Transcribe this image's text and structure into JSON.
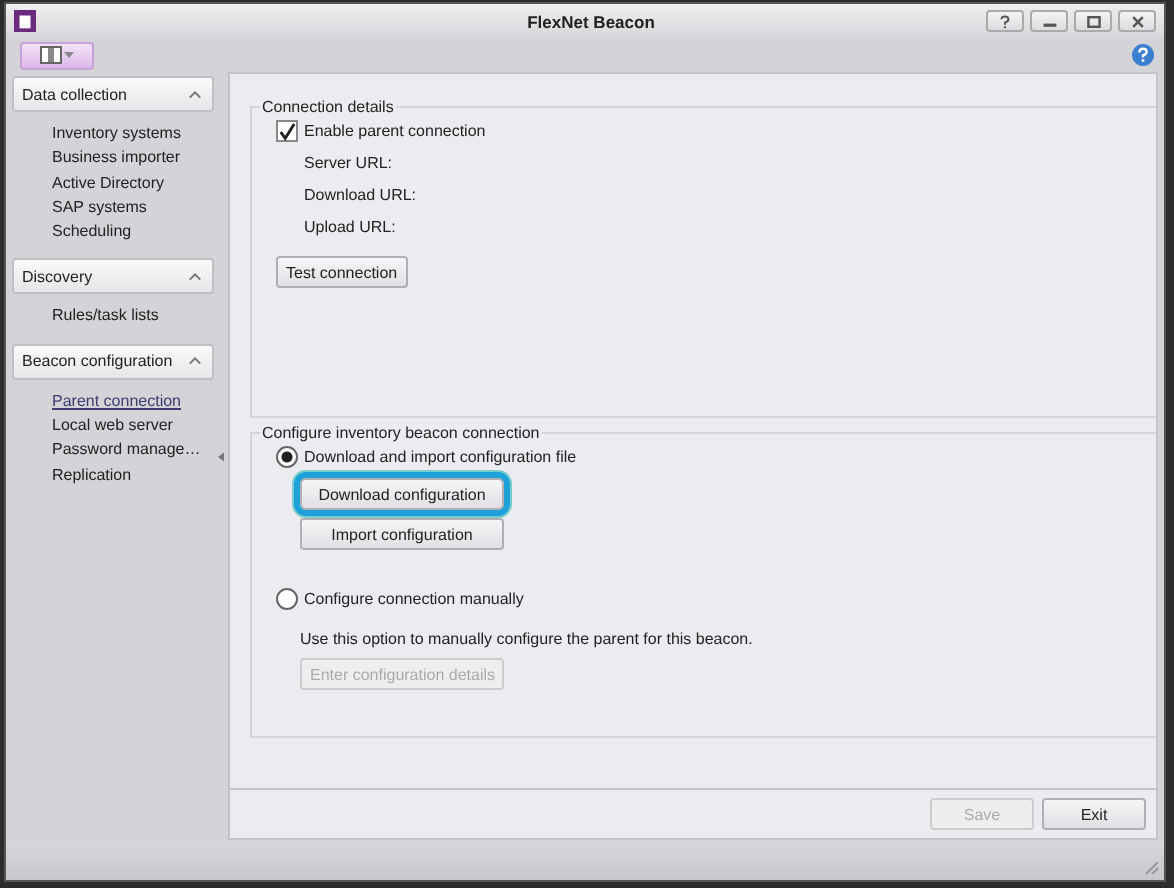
{
  "window": {
    "title": "FlexNet Beacon"
  },
  "sidebar": {
    "sections": [
      {
        "title": "Data collection",
        "expanded": true,
        "items": [
          {
            "label": "Inventory systems",
            "selected": false
          },
          {
            "label": "Business importer",
            "selected": false
          },
          {
            "label": "Active Directory",
            "selected": false
          },
          {
            "label": "SAP systems",
            "selected": false
          },
          {
            "label": "Scheduling",
            "selected": false
          }
        ]
      },
      {
        "title": "Discovery",
        "expanded": true,
        "items": [
          {
            "label": "Rules/task lists",
            "selected": false
          }
        ]
      },
      {
        "title": "Beacon configuration",
        "expanded": true,
        "items": [
          {
            "label": "Parent connection",
            "selected": true
          },
          {
            "label": "Local web server",
            "selected": false
          },
          {
            "label": "Password manage…",
            "selected": false
          },
          {
            "label": "Replication",
            "selected": false
          }
        ]
      }
    ]
  },
  "connection_details": {
    "title": "Connection details",
    "enable_parent": {
      "label": "Enable parent connection",
      "checked": true
    },
    "fields": [
      "Server URL:",
      "Download URL:",
      "Upload URL:"
    ],
    "test_button": "Test connection"
  },
  "configure": {
    "title": "Configure inventory beacon connection",
    "options": [
      {
        "label": "Download and import configuration file",
        "selected": true,
        "buttons": [
          {
            "label": "Download configuration",
            "highlighted": true,
            "disabled": false
          },
          {
            "label": "Import configuration",
            "highlighted": false,
            "disabled": false
          }
        ]
      },
      {
        "label": "Configure connection manually",
        "selected": false,
        "description": "Use this option to manually configure the parent for this beacon.",
        "buttons": [
          {
            "label": "Enter configuration details",
            "highlighted": false,
            "disabled": true
          }
        ]
      }
    ]
  },
  "footer": {
    "buttons": [
      {
        "label": "Save",
        "disabled": true
      },
      {
        "label": "Exit",
        "disabled": false
      }
    ]
  }
}
